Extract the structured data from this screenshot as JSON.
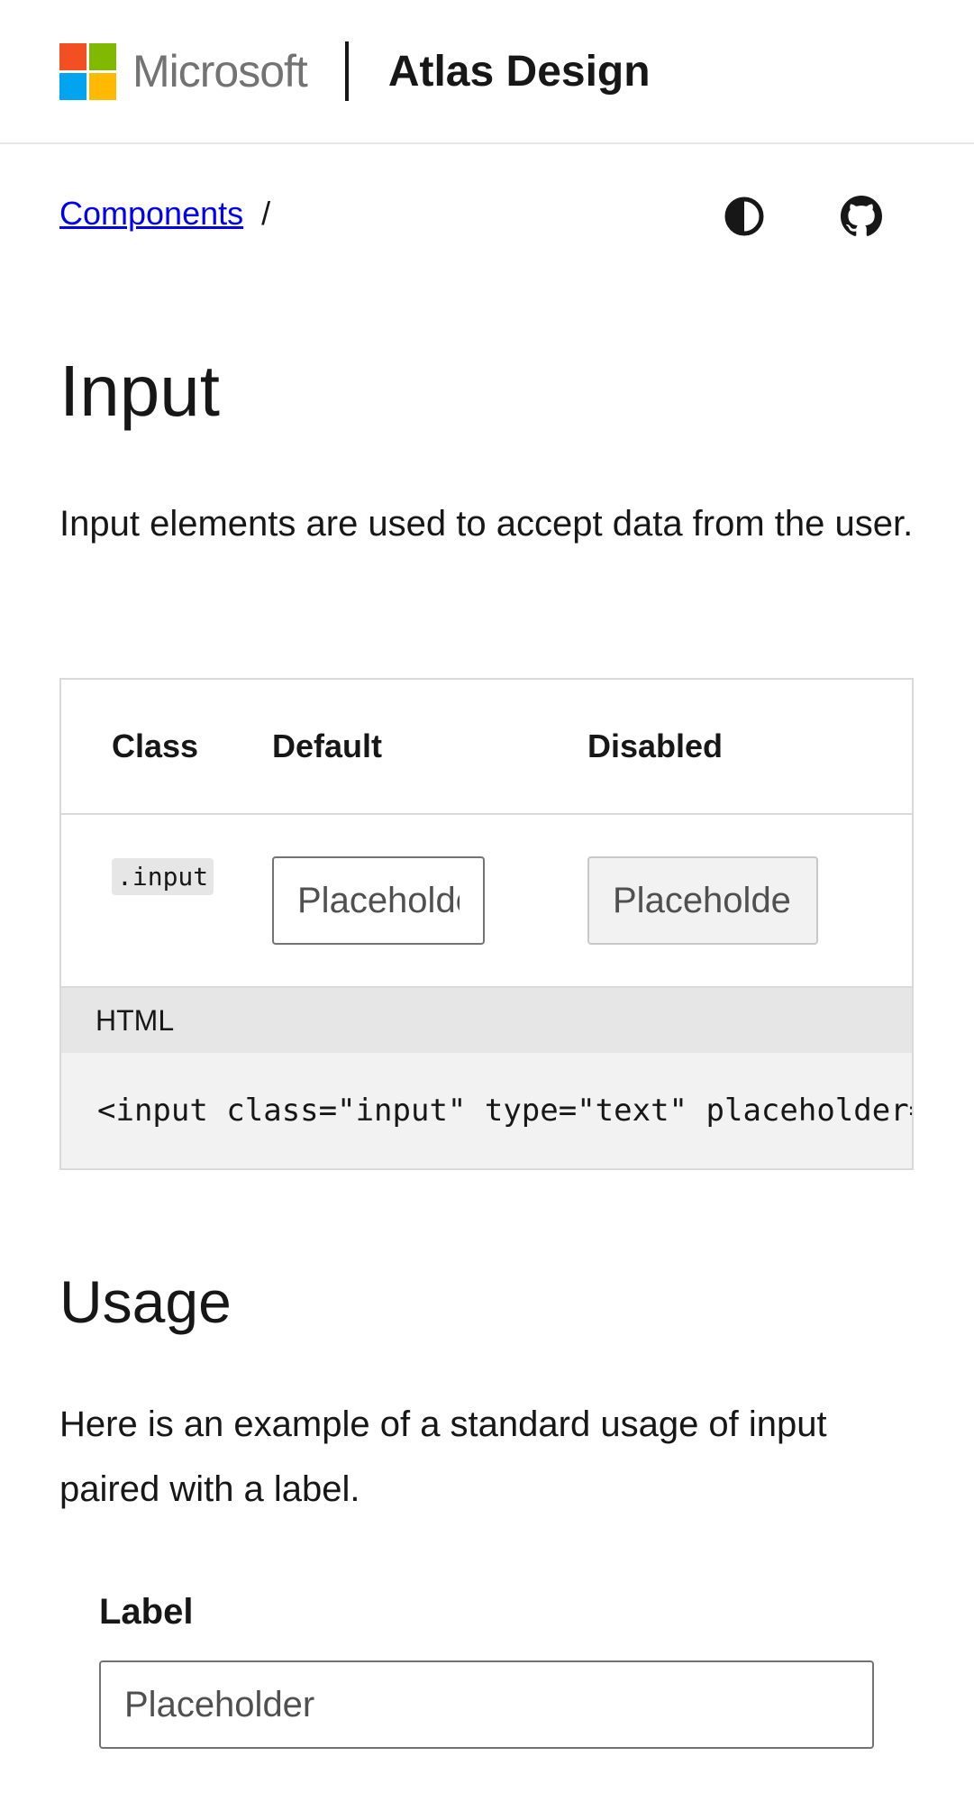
{
  "header": {
    "brand": "Microsoft",
    "site_title": "Atlas Design",
    "logo_colors": [
      "#f25022",
      "#7fba00",
      "#00a4ef",
      "#ffb900"
    ]
  },
  "breadcrumb": {
    "link": "Components",
    "separator": "/"
  },
  "toolbar": {
    "theme_icon": "contrast-icon",
    "github_icon": "github-icon"
  },
  "page": {
    "title": "Input",
    "intro": "Input elements are used to accept data from the user."
  },
  "example_table": {
    "headers": [
      "Class",
      "Default",
      "Disabled"
    ],
    "row": {
      "class": ".input",
      "default_placeholder": "Placeholder",
      "disabled_placeholder": "Placeholder"
    },
    "code_label": "HTML",
    "code": "<input class=\"input\" type=\"text\" placeholder=\"Placeholder\" />"
  },
  "usage": {
    "title": "Usage",
    "text": "Here is an example of a standard usage of input paired with a label.",
    "label": "Label",
    "placeholder": "Placeholder"
  }
}
